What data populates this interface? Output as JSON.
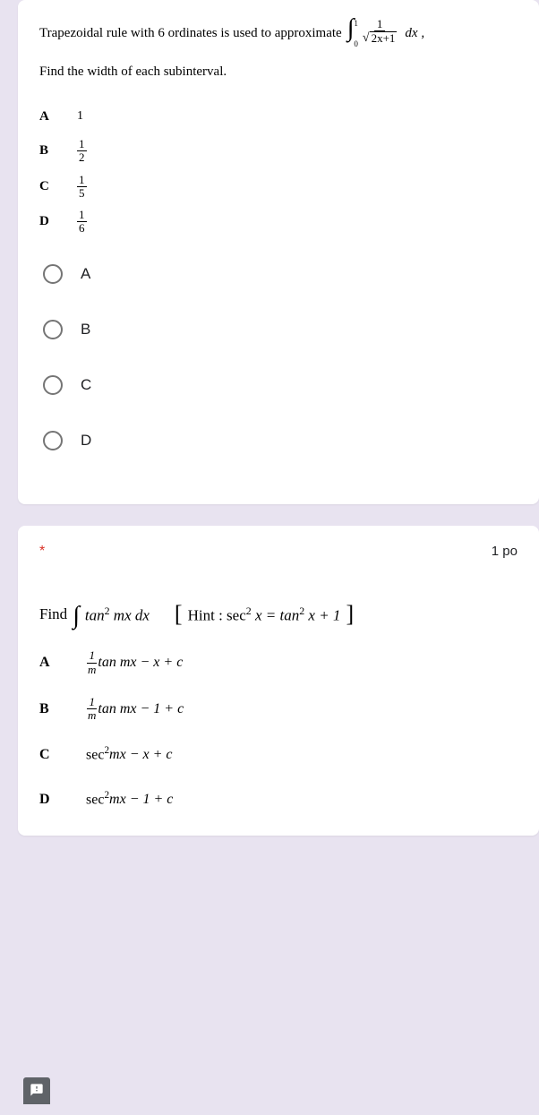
{
  "q1": {
    "line1_prefix": "Trapezoidal rule with 6 ordinates is used to approximate",
    "integral_upper": "1",
    "integral_lower": "0",
    "integrand_num": "1",
    "integrand_den_root": "2x+1",
    "dx_suffix": "dx ,",
    "line2": "Find the width of each subinterval.",
    "options": {
      "A": {
        "label": "A",
        "num": "1",
        "whole": true
      },
      "B": {
        "label": "B",
        "num": "1",
        "den": "2"
      },
      "C": {
        "label": "C",
        "num": "1",
        "den": "5"
      },
      "D": {
        "label": "D",
        "num": "1",
        "den": "6"
      }
    },
    "radios": [
      "A",
      "B",
      "C",
      "D"
    ]
  },
  "q2": {
    "required": "*",
    "points": "1 po",
    "find": "Find",
    "integrand": "tan",
    "exp": "2",
    "mxdx": " mx dx",
    "hint_prefix": "Hint : sec",
    "hint_eq": " x = tan",
    "hint_tail": " x + 1",
    "options": {
      "A": {
        "label": "A",
        "fracnum": "1",
        "fracden": "m",
        "tail": " tan mx − x + c"
      },
      "B": {
        "label": "B",
        "fracnum": "1",
        "fracden": "m",
        "tail": " tan mx − 1 + c"
      },
      "C": {
        "label": "C",
        "text": "sec",
        "exp": "2",
        "tail": " mx − x + c"
      },
      "D": {
        "label": "D",
        "text": "sec",
        "exp": "2",
        "tail": " mx − 1 + c"
      }
    }
  },
  "icons": {
    "report": "!"
  }
}
